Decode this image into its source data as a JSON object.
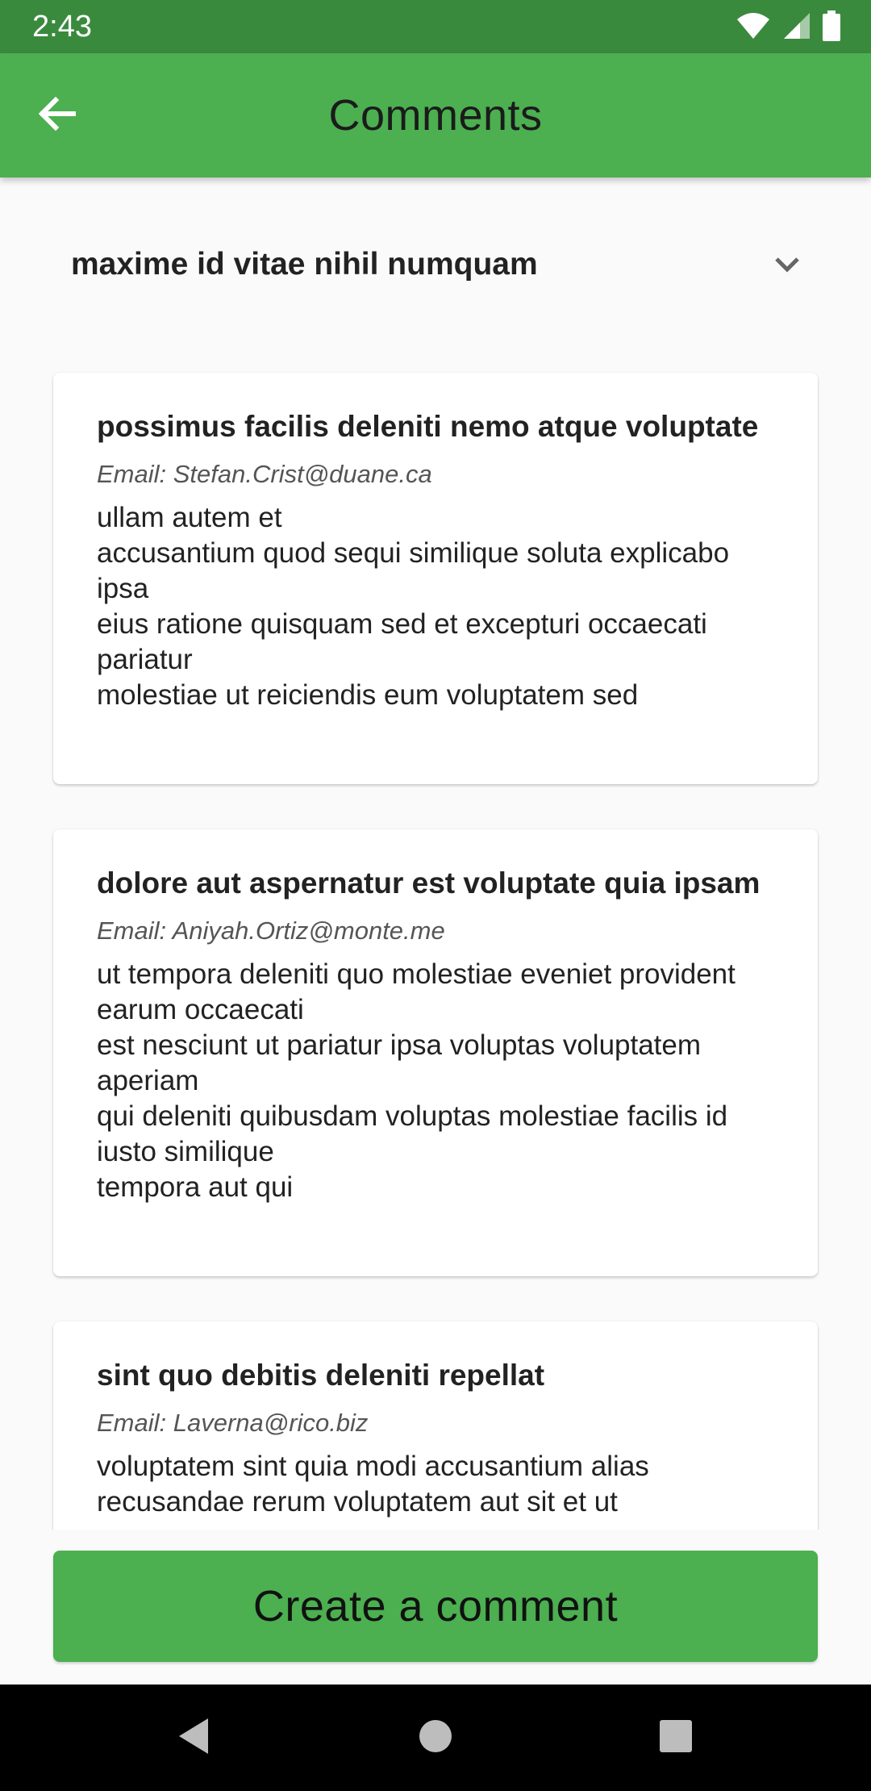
{
  "status_bar": {
    "time": "2:43",
    "icons": [
      "wifi-icon",
      "signal-icon",
      "battery-icon"
    ]
  },
  "app_bar": {
    "title": "Comments",
    "back_icon": "arrow-back-icon"
  },
  "post_selector": {
    "selected": "maxime id vitae nihil numquam",
    "icon": "chevron-down-icon"
  },
  "comments": [
    {
      "title": "possimus facilis deleniti nemo atque voluptate",
      "email": "Email: Stefan.Crist@duane.ca",
      "body": "ullam autem et\naccusantium quod sequi similique soluta explicabo ipsa\neius ratione quisquam sed et excepturi occaecati pariatur\nmolestiae ut reiciendis eum voluptatem sed"
    },
    {
      "title": "dolore aut aspernatur est voluptate quia ipsam",
      "email": "Email: Aniyah.Ortiz@monte.me",
      "body": "ut tempora deleniti quo molestiae eveniet provident earum occaecati\nest nesciunt ut pariatur ipsa voluptas voluptatem aperiam\nqui deleniti quibusdam voluptas molestiae facilis id iusto similique\ntempora aut qui"
    },
    {
      "title": "sint quo debitis deleniti repellat",
      "email": "Email: Laverna@rico.biz",
      "body": "voluptatem sint quia modi accusantium alias\nrecusandae rerum voluptatem aut sit et ut"
    }
  ],
  "create_button": {
    "label": "Create a comment"
  },
  "colors": {
    "status_bar": "#3a8a3e",
    "primary": "#4caf50",
    "background": "#fafafa",
    "card": "#ffffff"
  }
}
